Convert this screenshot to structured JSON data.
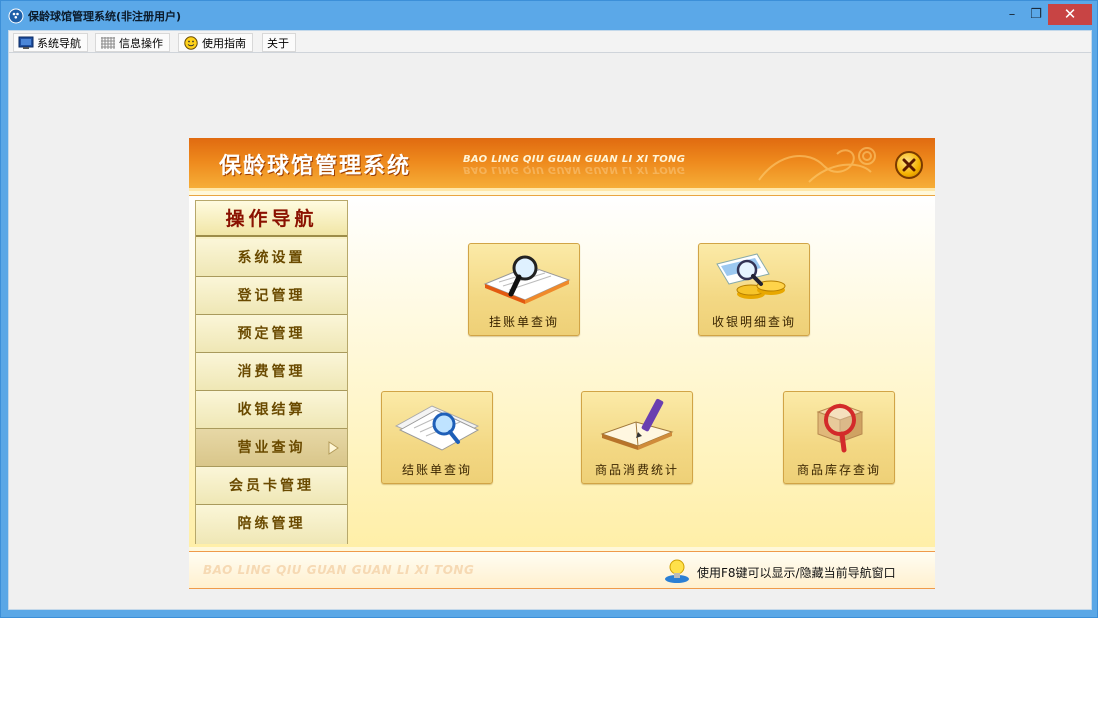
{
  "window": {
    "title": "保龄球馆管理系统(非注册用户)",
    "controls": {
      "minimize": "–",
      "maximize": "❐",
      "close": "✕"
    }
  },
  "menubar": {
    "items": [
      {
        "label": "系统导航",
        "icon": "monitor-icon"
      },
      {
        "label": "信息操作",
        "icon": "grid-icon"
      },
      {
        "label": "使用指南",
        "icon": "smiley-icon"
      },
      {
        "label": "关于",
        "icon": ""
      }
    ]
  },
  "dialog": {
    "title": "保龄球馆管理系统",
    "subtitle": "BAO LING QIU GUAN GUAN LI XI TONG",
    "close_icon": "close-icon",
    "nav": {
      "heading": "操作导航",
      "items": [
        {
          "label": "系统设置",
          "active": false
        },
        {
          "label": "登记管理",
          "active": false
        },
        {
          "label": "预定管理",
          "active": false
        },
        {
          "label": "消费管理",
          "active": false
        },
        {
          "label": "收银结算",
          "active": false
        },
        {
          "label": "营业查询",
          "active": true
        },
        {
          "label": "会员卡管理",
          "active": false
        },
        {
          "label": "陪练管理",
          "active": false
        }
      ]
    },
    "tiles": [
      {
        "label": "挂账单查询",
        "icon": "ledger-search-icon"
      },
      {
        "label": "收银明细查询",
        "icon": "coins-search-icon"
      },
      {
        "label": "结账单查询",
        "icon": "bill-search-icon"
      },
      {
        "label": "商品消费统计",
        "icon": "book-pen-icon"
      },
      {
        "label": "商品库存查询",
        "icon": "box-search-icon"
      }
    ],
    "footer": {
      "watermark": "BAO LING QIU GUAN GUAN LI XI TONG",
      "hint": "使用F8键可以显示/隐藏当前导航窗口"
    }
  },
  "colors": {
    "title_bar": "#5ba8e8",
    "header_orange": "#ee8a1d",
    "nav_text": "#6a4a00",
    "nav_heading": "#8a1100",
    "tile_bg": "#f3d884"
  }
}
